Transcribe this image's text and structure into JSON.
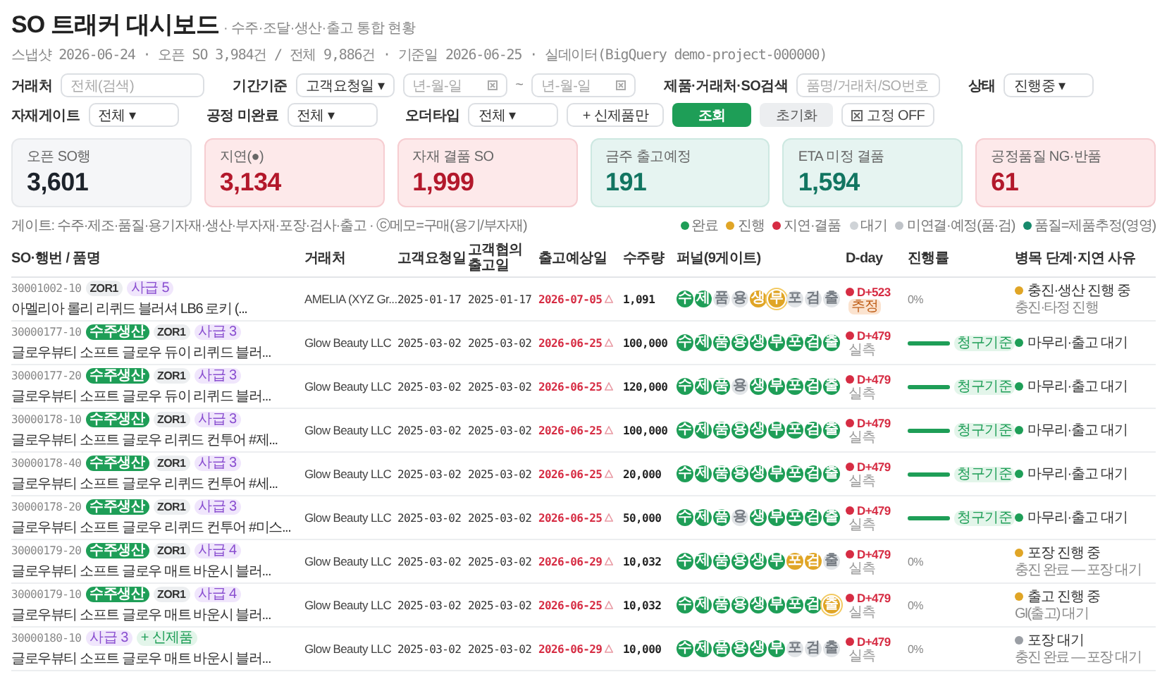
{
  "header": {
    "title": "SO 트래커 대시보드",
    "subtitle": "· 수주·조달·생산·출고 통합 현황",
    "meta": "스냅샷 2026-06-24 · 오픈 SO 3,984건 / 전체 9,886건 · 기준일 2026-06-25 · 실데이터(BigQuery demo-project-000000)"
  },
  "filters": [
    [
      {
        "kind": "label",
        "text": "거래처"
      },
      {
        "kind": "input",
        "placeholder": "전체(검색)"
      },
      {
        "kind": "label",
        "text": "기간기준"
      },
      {
        "kind": "select",
        "value": "고객요청일 ▾"
      },
      {
        "kind": "date",
        "placeholder": "년-월-일"
      },
      {
        "kind": "sep",
        "text": "~"
      },
      {
        "kind": "date",
        "placeholder": "년-월-일"
      },
      {
        "kind": "label",
        "text": "제품·거래처·SO검색"
      },
      {
        "kind": "input",
        "placeholder": "품명/거래처/SO번호"
      },
      {
        "kind": "label",
        "text": "상태"
      },
      {
        "kind": "select",
        "value": "진행중 ▾"
      }
    ],
    [
      {
        "kind": "label",
        "text": "자재게이트"
      },
      {
        "kind": "select",
        "value": "전체 ▾"
      },
      {
        "kind": "label",
        "text": "공정 미완료"
      },
      {
        "kind": "select",
        "value": "전체 ▾"
      },
      {
        "kind": "label",
        "text": "오더타입"
      },
      {
        "kind": "select",
        "value": "전체 ▾"
      },
      {
        "kind": "toggle",
        "text": "+ 신제품만"
      },
      {
        "kind": "primary",
        "text": "조회"
      },
      {
        "kind": "secondary",
        "text": "초기화"
      },
      {
        "kind": "pin",
        "text": "고정 OFF"
      }
    ]
  ],
  "kpis": [
    {
      "label": "오픈 SO행",
      "value": "3,601",
      "kind": "neutral"
    },
    {
      "label": "지연(●)",
      "value": "3,134",
      "kind": "alert"
    },
    {
      "label": "자재 결품 SO",
      "value": "1,999",
      "kind": "alert"
    },
    {
      "label": "금주 출고예정",
      "value": "191",
      "kind": "good"
    },
    {
      "label": "ETA 미정 결품",
      "value": "1,594",
      "kind": "good"
    },
    {
      "label": "공정품질 NG·반품",
      "value": "61",
      "kind": "alert"
    }
  ],
  "legend": {
    "text": "게이트: 수주·제조·품질·용기자재·생산·부자재·포장·검사·출고 · ⓒ메모=구매(용기/부자재)",
    "items": [
      {
        "color": "#1e9e57",
        "text": "완료"
      },
      {
        "color": "#e0a526",
        "text": "진행"
      },
      {
        "color": "#d62c43",
        "text": "지연·결품"
      },
      {
        "color": "#cfd3d7",
        "text": "대기"
      },
      {
        "color": "#bfc3c8",
        "text": "미연결·예정(품·검)"
      },
      {
        "color": "#178a6c",
        "text": "품질=제품추정(영영)"
      }
    ]
  },
  "table": {
    "columns": [
      "SO·행번 / 품명",
      "거래처",
      "고객요청일",
      "고객협의 출고일",
      "출고예상일",
      "수주량",
      "퍼널(9게이트)",
      "D-day",
      "진행률",
      "병목 단계·지연 사유"
    ],
    "rows": [
      {
        "so": "30001002-10",
        "tags": [
          {
            "kind": "order",
            "text": "ZOR1"
          },
          {
            "kind": "supply",
            "text": "사급 5"
          }
        ],
        "name": "아멜리아 롤리 리퀴드 블러셔 LB6 로키 (...",
        "customer": "AMELIA (XYZ Gr...",
        "requested": "2025-01-17",
        "agreed": "2025-01-17",
        "eta": "2026-07-05",
        "late": true,
        "qty": "1,091",
        "gates": [
          {
            "label": "수",
            "kind": "done"
          },
          {
            "label": "제",
            "kind": "done"
          },
          {
            "label": "품",
            "kind": "wait"
          },
          {
            "label": "용",
            "kind": "wait"
          },
          {
            "label": "생",
            "kind": "progress"
          },
          {
            "label": "부",
            "kind": "current"
          },
          {
            "label": "포",
            "kind": "wait"
          },
          {
            "label": "검",
            "kind": "wait"
          },
          {
            "label": "출",
            "kind": "wait"
          }
        ],
        "dday": {
          "text": "D+523",
          "note": "추정",
          "kind": "estimate"
        },
        "progress": {
          "kind": "percent",
          "text": "0%"
        },
        "status": {
          "color": "#e0a526",
          "text": "충진·생산 진행 중",
          "note": "충진·타정 진행"
        }
      },
      {
        "so": "30000177-10",
        "tags": [
          {
            "kind": "make",
            "text": "수주생산"
          },
          {
            "kind": "order",
            "text": "ZOR1"
          },
          {
            "kind": "supply",
            "text": "사급 3"
          }
        ],
        "name": "글로우뷰티 소프트 글로우 듀이 리퀴드 블러...",
        "customer": "Glow Beauty LLC",
        "requested": "2025-03-02",
        "agreed": "2025-03-02",
        "eta": "2026-06-25",
        "late": true,
        "qty": "100,000",
        "gates": [
          {
            "label": "수",
            "kind": "done"
          },
          {
            "label": "제",
            "kind": "done"
          },
          {
            "label": "품",
            "kind": "done"
          },
          {
            "label": "용",
            "kind": "done"
          },
          {
            "label": "생",
            "kind": "done"
          },
          {
            "label": "부",
            "kind": "done"
          },
          {
            "label": "포",
            "kind": "done"
          },
          {
            "label": "검",
            "kind": "done"
          },
          {
            "label": "출",
            "kind": "done"
          }
        ],
        "dday": {
          "text": "D+479",
          "note": "실측",
          "kind": "measured"
        },
        "progress": {
          "kind": "bar",
          "level": 1,
          "badge": "청구기준"
        },
        "status": {
          "color": "#1e9e57",
          "text": "마무리·출고 대기"
        }
      },
      {
        "so": "30000177-20",
        "tags": [
          {
            "kind": "make",
            "text": "수주생산"
          },
          {
            "kind": "order",
            "text": "ZOR1"
          },
          {
            "kind": "supply",
            "text": "사급 3"
          }
        ],
        "name": "글로우뷰티 소프트 글로우 듀이 리퀴드 블러...",
        "customer": "Glow Beauty LLC",
        "requested": "2025-03-02",
        "agreed": "2025-03-02",
        "eta": "2026-06-25",
        "late": true,
        "qty": "120,000",
        "gates": [
          {
            "label": "수",
            "kind": "done"
          },
          {
            "label": "제",
            "kind": "done"
          },
          {
            "label": "품",
            "kind": "done"
          },
          {
            "label": "용",
            "kind": "wait"
          },
          {
            "label": "생",
            "kind": "done"
          },
          {
            "label": "부",
            "kind": "done"
          },
          {
            "label": "포",
            "kind": "done"
          },
          {
            "label": "검",
            "kind": "done"
          },
          {
            "label": "출",
            "kind": "done"
          }
        ],
        "dday": {
          "text": "D+479",
          "note": "실측",
          "kind": "measured"
        },
        "progress": {
          "kind": "bar",
          "level": 1,
          "badge": "청구기준"
        },
        "status": {
          "color": "#1e9e57",
          "text": "마무리·출고 대기"
        }
      },
      {
        "so": "30000178-10",
        "tags": [
          {
            "kind": "make",
            "text": "수주생산"
          },
          {
            "kind": "order",
            "text": "ZOR1"
          },
          {
            "kind": "supply",
            "text": "사급 3"
          }
        ],
        "name": "글로우뷰티 소프트 글로우 리퀴드 컨투어 #제...",
        "customer": "Glow Beauty LLC",
        "requested": "2025-03-02",
        "agreed": "2025-03-02",
        "eta": "2026-06-25",
        "late": true,
        "qty": "100,000",
        "gates": [
          {
            "label": "수",
            "kind": "done"
          },
          {
            "label": "제",
            "kind": "done"
          },
          {
            "label": "품",
            "kind": "done"
          },
          {
            "label": "용",
            "kind": "done"
          },
          {
            "label": "생",
            "kind": "done"
          },
          {
            "label": "부",
            "kind": "done"
          },
          {
            "label": "포",
            "kind": "done"
          },
          {
            "label": "검",
            "kind": "done"
          },
          {
            "label": "출",
            "kind": "done"
          }
        ],
        "dday": {
          "text": "D+479",
          "note": "실측",
          "kind": "measured"
        },
        "progress": {
          "kind": "bar",
          "level": 1,
          "badge": "청구기준"
        },
        "status": {
          "color": "#1e9e57",
          "text": "마무리·출고 대기"
        }
      },
      {
        "so": "30000178-40",
        "tags": [
          {
            "kind": "make",
            "text": "수주생산"
          },
          {
            "kind": "order",
            "text": "ZOR1"
          },
          {
            "kind": "supply",
            "text": "사급 3"
          }
        ],
        "name": "글로우뷰티 소프트 글로우 리퀴드 컨투어 #세...",
        "customer": "Glow Beauty LLC",
        "requested": "2025-03-02",
        "agreed": "2025-03-02",
        "eta": "2026-06-25",
        "late": true,
        "qty": "20,000",
        "gates": [
          {
            "label": "수",
            "kind": "done"
          },
          {
            "label": "제",
            "kind": "done"
          },
          {
            "label": "품",
            "kind": "done"
          },
          {
            "label": "용",
            "kind": "done"
          },
          {
            "label": "생",
            "kind": "done"
          },
          {
            "label": "부",
            "kind": "done"
          },
          {
            "label": "포",
            "kind": "done"
          },
          {
            "label": "검",
            "kind": "done"
          },
          {
            "label": "출",
            "kind": "done"
          }
        ],
        "dday": {
          "text": "D+479",
          "note": "실측",
          "kind": "measured"
        },
        "progress": {
          "kind": "bar",
          "level": 1,
          "badge": "청구기준"
        },
        "status": {
          "color": "#1e9e57",
          "text": "마무리·출고 대기"
        }
      },
      {
        "so": "30000178-20",
        "tags": [
          {
            "kind": "make",
            "text": "수주생산"
          },
          {
            "kind": "order",
            "text": "ZOR1"
          },
          {
            "kind": "supply",
            "text": "사급 3"
          }
        ],
        "name": "글로우뷰티 소프트 글로우 리퀴드 컨투어 #미스...",
        "customer": "Glow Beauty LLC",
        "requested": "2025-03-02",
        "agreed": "2025-03-02",
        "eta": "2026-06-25",
        "late": true,
        "qty": "50,000",
        "gates": [
          {
            "label": "수",
            "kind": "done"
          },
          {
            "label": "제",
            "kind": "done"
          },
          {
            "label": "품",
            "kind": "done"
          },
          {
            "label": "용",
            "kind": "wait"
          },
          {
            "label": "생",
            "kind": "done"
          },
          {
            "label": "부",
            "kind": "done"
          },
          {
            "label": "포",
            "kind": "done"
          },
          {
            "label": "검",
            "kind": "done"
          },
          {
            "label": "출",
            "kind": "done"
          }
        ],
        "dday": {
          "text": "D+479",
          "note": "실측",
          "kind": "measured"
        },
        "progress": {
          "kind": "bar",
          "level": 1,
          "badge": "청구기준"
        },
        "status": {
          "color": "#1e9e57",
          "text": "마무리·출고 대기"
        }
      },
      {
        "so": "30000179-20",
        "tags": [
          {
            "kind": "make",
            "text": "수주생산"
          },
          {
            "kind": "order",
            "text": "ZOR1"
          },
          {
            "kind": "supply",
            "text": "사급 4"
          }
        ],
        "name": "글로우뷰티 소프트 글로우 매트 바운시 블러...",
        "customer": "Glow Beauty LLC",
        "requested": "2025-03-02",
        "agreed": "2025-03-02",
        "eta": "2026-06-29",
        "late": true,
        "qty": "10,032",
        "gates": [
          {
            "label": "수",
            "kind": "done"
          },
          {
            "label": "제",
            "kind": "done"
          },
          {
            "label": "품",
            "kind": "done"
          },
          {
            "label": "용",
            "kind": "done"
          },
          {
            "label": "생",
            "kind": "done"
          },
          {
            "label": "부",
            "kind": "done"
          },
          {
            "label": "포",
            "kind": "progress"
          },
          {
            "label": "검",
            "kind": "progress"
          },
          {
            "label": "출",
            "kind": "wait"
          }
        ],
        "dday": {
          "text": "D+479",
          "note": "실측",
          "kind": "measured"
        },
        "progress": {
          "kind": "percent",
          "text": "0%"
        },
        "status": {
          "color": "#e0a526",
          "text": "포장 진행 중",
          "note": "충진 완료 — 포장 대기"
        }
      },
      {
        "so": "30000179-10",
        "tags": [
          {
            "kind": "make",
            "text": "수주생산"
          },
          {
            "kind": "order",
            "text": "ZOR1"
          },
          {
            "kind": "supply",
            "text": "사급 4"
          }
        ],
        "name": "글로우뷰티 소프트 글로우 매트 바운시 블러...",
        "customer": "Glow Beauty LLC",
        "requested": "2025-03-02",
        "agreed": "2025-03-02",
        "eta": "2026-06-25",
        "late": true,
        "qty": "10,032",
        "gates": [
          {
            "label": "수",
            "kind": "done"
          },
          {
            "label": "제",
            "kind": "done"
          },
          {
            "label": "품",
            "kind": "done"
          },
          {
            "label": "용",
            "kind": "done"
          },
          {
            "label": "생",
            "kind": "done"
          },
          {
            "label": "부",
            "kind": "done"
          },
          {
            "label": "포",
            "kind": "done"
          },
          {
            "label": "검",
            "kind": "done"
          },
          {
            "label": "출",
            "kind": "current"
          }
        ],
        "dday": {
          "text": "D+479",
          "note": "실측",
          "kind": "measured"
        },
        "progress": {
          "kind": "percent",
          "text": "0%"
        },
        "status": {
          "color": "#e0a526",
          "text": "출고 진행 중",
          "note": "GI(출고) 대기"
        }
      },
      {
        "so": "30000180-10",
        "tags": [
          {
            "kind": "supply",
            "text": "사급 3"
          },
          {
            "kind": "new",
            "text": "+ 신제품"
          }
        ],
        "name": "글로우뷰티 소프트 글로우 매트 바운시 블러...",
        "customer": "Glow Beauty LLC",
        "requested": "2025-03-02",
        "agreed": "2025-03-02",
        "eta": "2026-06-29",
        "late": true,
        "qty": "10,000",
        "gates": [
          {
            "label": "수",
            "kind": "done"
          },
          {
            "label": "제",
            "kind": "done"
          },
          {
            "label": "품",
            "kind": "done"
          },
          {
            "label": "용",
            "kind": "done"
          },
          {
            "label": "생",
            "kind": "done"
          },
          {
            "label": "부",
            "kind": "done"
          },
          {
            "label": "포",
            "kind": "wait"
          },
          {
            "label": "검",
            "kind": "wait"
          },
          {
            "label": "출",
            "kind": "wait"
          }
        ],
        "dday": {
          "text": "D+479",
          "note": "실측",
          "kind": "measured"
        },
        "progress": {
          "kind": "percent",
          "text": "0%"
        },
        "status": {
          "color": "#9a9ea4",
          "text": "포장 대기",
          "note": "충진 완료 — 포장 대기"
        }
      }
    ]
  }
}
